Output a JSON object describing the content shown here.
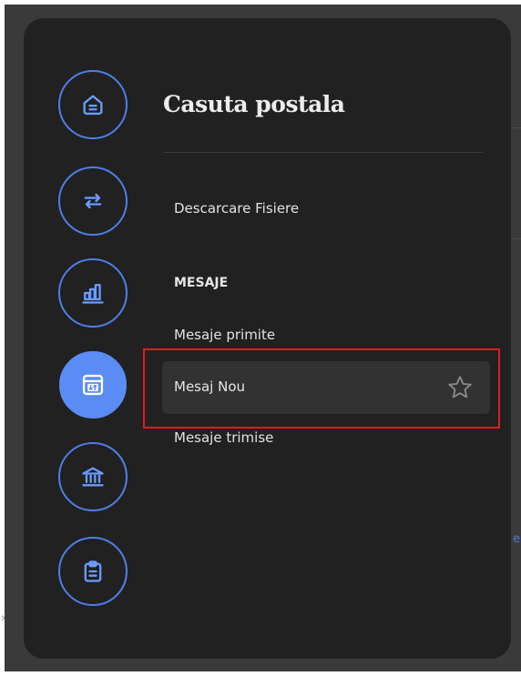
{
  "colors": {
    "panel_bg": "#212121",
    "accent": "#5b8cf5",
    "highlight_bg": "#323232",
    "annotation_outline": "#e01b24"
  },
  "rail": [
    {
      "icon": "home-icon",
      "active": false
    },
    {
      "icon": "transfer-arrows-icon",
      "active": false
    },
    {
      "icon": "bar-chart-icon",
      "active": false
    },
    {
      "icon": "mailbox-icon",
      "active": true
    },
    {
      "icon": "bank-icon",
      "active": false
    },
    {
      "icon": "clipboard-icon",
      "active": false
    }
  ],
  "menu": {
    "title": "Casuta postala",
    "download_link": "Descarcare Fisiere",
    "section_heading": "MESAJE",
    "received_link": "Mesaje primite",
    "new_message_link": "Mesaj Nou",
    "sent_link": "Mesaje trimise"
  }
}
